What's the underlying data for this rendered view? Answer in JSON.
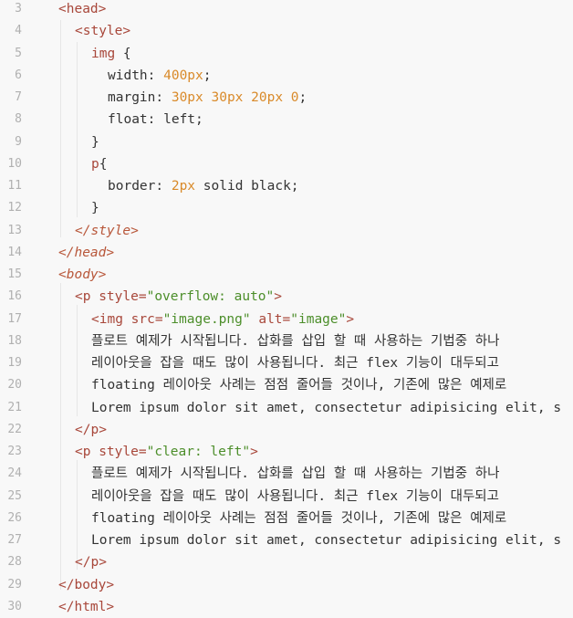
{
  "colors": {
    "background": "#f8f8f8",
    "line_number": "#b0b0b0",
    "tag": "#a8473a",
    "string": "#4c8e2a",
    "number": "#d98a2a",
    "text": "#333333"
  },
  "lines": [
    {
      "num": "3",
      "indent": 0,
      "parts": [
        {
          "t": "tag",
          "v": "<head>"
        }
      ]
    },
    {
      "num": "4",
      "indent": 1,
      "parts": [
        {
          "t": "tag",
          "v": "<style>"
        }
      ]
    },
    {
      "num": "5",
      "indent": 2,
      "parts": [
        {
          "t": "tag",
          "v": "img"
        },
        {
          "t": "txt",
          "v": " {"
        }
      ]
    },
    {
      "num": "6",
      "indent": 3,
      "parts": [
        {
          "t": "prop",
          "v": "width: "
        },
        {
          "t": "num",
          "v": "400px"
        },
        {
          "t": "txt",
          "v": ";"
        }
      ]
    },
    {
      "num": "7",
      "indent": 3,
      "parts": [
        {
          "t": "prop",
          "v": "margin: "
        },
        {
          "t": "num",
          "v": "30px 30px 20px 0"
        },
        {
          "t": "txt",
          "v": ";"
        }
      ]
    },
    {
      "num": "8",
      "indent": 3,
      "parts": [
        {
          "t": "prop",
          "v": "float: left;"
        }
      ]
    },
    {
      "num": "9",
      "indent": 2,
      "parts": [
        {
          "t": "txt",
          "v": "}"
        }
      ]
    },
    {
      "num": "10",
      "indent": 2,
      "parts": [
        {
          "t": "tag",
          "v": "p"
        },
        {
          "t": "txt",
          "v": "{"
        }
      ]
    },
    {
      "num": "11",
      "indent": 3,
      "parts": [
        {
          "t": "prop",
          "v": "border: "
        },
        {
          "t": "num",
          "v": "2px"
        },
        {
          "t": "txt",
          "v": " solid black;"
        }
      ]
    },
    {
      "num": "12",
      "indent": 2,
      "parts": [
        {
          "t": "txt",
          "v": "}"
        }
      ]
    },
    {
      "num": "13",
      "indent": 1,
      "parts": [
        {
          "t": "tagi",
          "v": "</style>"
        }
      ]
    },
    {
      "num": "14",
      "indent": 0,
      "parts": [
        {
          "t": "tagi",
          "v": "</head>"
        }
      ]
    },
    {
      "num": "15",
      "indent": 0,
      "parts": [
        {
          "t": "tagi",
          "v": "<body>"
        }
      ]
    },
    {
      "num": "16",
      "indent": 1,
      "parts": [
        {
          "t": "tag",
          "v": "<p "
        },
        {
          "t": "attr",
          "v": "style="
        },
        {
          "t": "str",
          "v": "\"overflow: auto\""
        },
        {
          "t": "tag",
          "v": ">"
        }
      ]
    },
    {
      "num": "17",
      "indent": 2,
      "parts": [
        {
          "t": "tag",
          "v": "<img "
        },
        {
          "t": "attr",
          "v": "src="
        },
        {
          "t": "str",
          "v": "\"image.png\""
        },
        {
          "t": "attr",
          "v": " alt="
        },
        {
          "t": "str",
          "v": "\"image\""
        },
        {
          "t": "tag",
          "v": ">"
        }
      ]
    },
    {
      "num": "18",
      "indent": 2,
      "parts": [
        {
          "t": "txt",
          "v": "플로트 예제가 시작됩니다. 삽화를 삽입 할 때 사용하는 기법중 하나"
        }
      ]
    },
    {
      "num": "19",
      "indent": 2,
      "parts": [
        {
          "t": "txt",
          "v": "레이아웃을 잡을 때도 많이 사용됩니다. 최근 flex 기능이 대두되고"
        }
      ]
    },
    {
      "num": "20",
      "indent": 2,
      "parts": [
        {
          "t": "txt",
          "v": "floating 레이아웃 사례는 점점 줄어들 것이나, 기존에 많은 예제로"
        }
      ]
    },
    {
      "num": "21",
      "indent": 2,
      "parts": [
        {
          "t": "txt",
          "v": "Lorem ipsum dolor sit amet, consectetur adipisicing elit, s"
        }
      ]
    },
    {
      "num": "22",
      "indent": 1,
      "parts": [
        {
          "t": "tag",
          "v": "</p>"
        }
      ]
    },
    {
      "num": "23",
      "indent": 1,
      "parts": [
        {
          "t": "tag",
          "v": "<p "
        },
        {
          "t": "attr",
          "v": "style="
        },
        {
          "t": "str",
          "v": "\"clear: left\""
        },
        {
          "t": "tag",
          "v": ">"
        }
      ]
    },
    {
      "num": "24",
      "indent": 2,
      "parts": [
        {
          "t": "txt",
          "v": "플로트 예제가 시작됩니다. 삽화를 삽입 할 때 사용하는 기법중 하나"
        }
      ]
    },
    {
      "num": "25",
      "indent": 2,
      "parts": [
        {
          "t": "txt",
          "v": "레이아웃을 잡을 때도 많이 사용됩니다. 최근 flex 기능이 대두되고"
        }
      ]
    },
    {
      "num": "26",
      "indent": 2,
      "parts": [
        {
          "t": "txt",
          "v": "floating 레이아웃 사례는 점점 줄어들 것이나, 기존에 많은 예제로"
        }
      ]
    },
    {
      "num": "27",
      "indent": 2,
      "parts": [
        {
          "t": "txt",
          "v": "Lorem ipsum dolor sit amet, consectetur adipisicing elit, s"
        }
      ]
    },
    {
      "num": "28",
      "indent": 1,
      "parts": [
        {
          "t": "tag",
          "v": "</p>"
        }
      ]
    },
    {
      "num": "29",
      "indent": 0,
      "parts": [
        {
          "t": "tag",
          "v": "</body>"
        }
      ]
    },
    {
      "num": "30",
      "indent": 0,
      "parts": [
        {
          "t": "tag",
          "v": "</html>"
        }
      ]
    }
  ]
}
